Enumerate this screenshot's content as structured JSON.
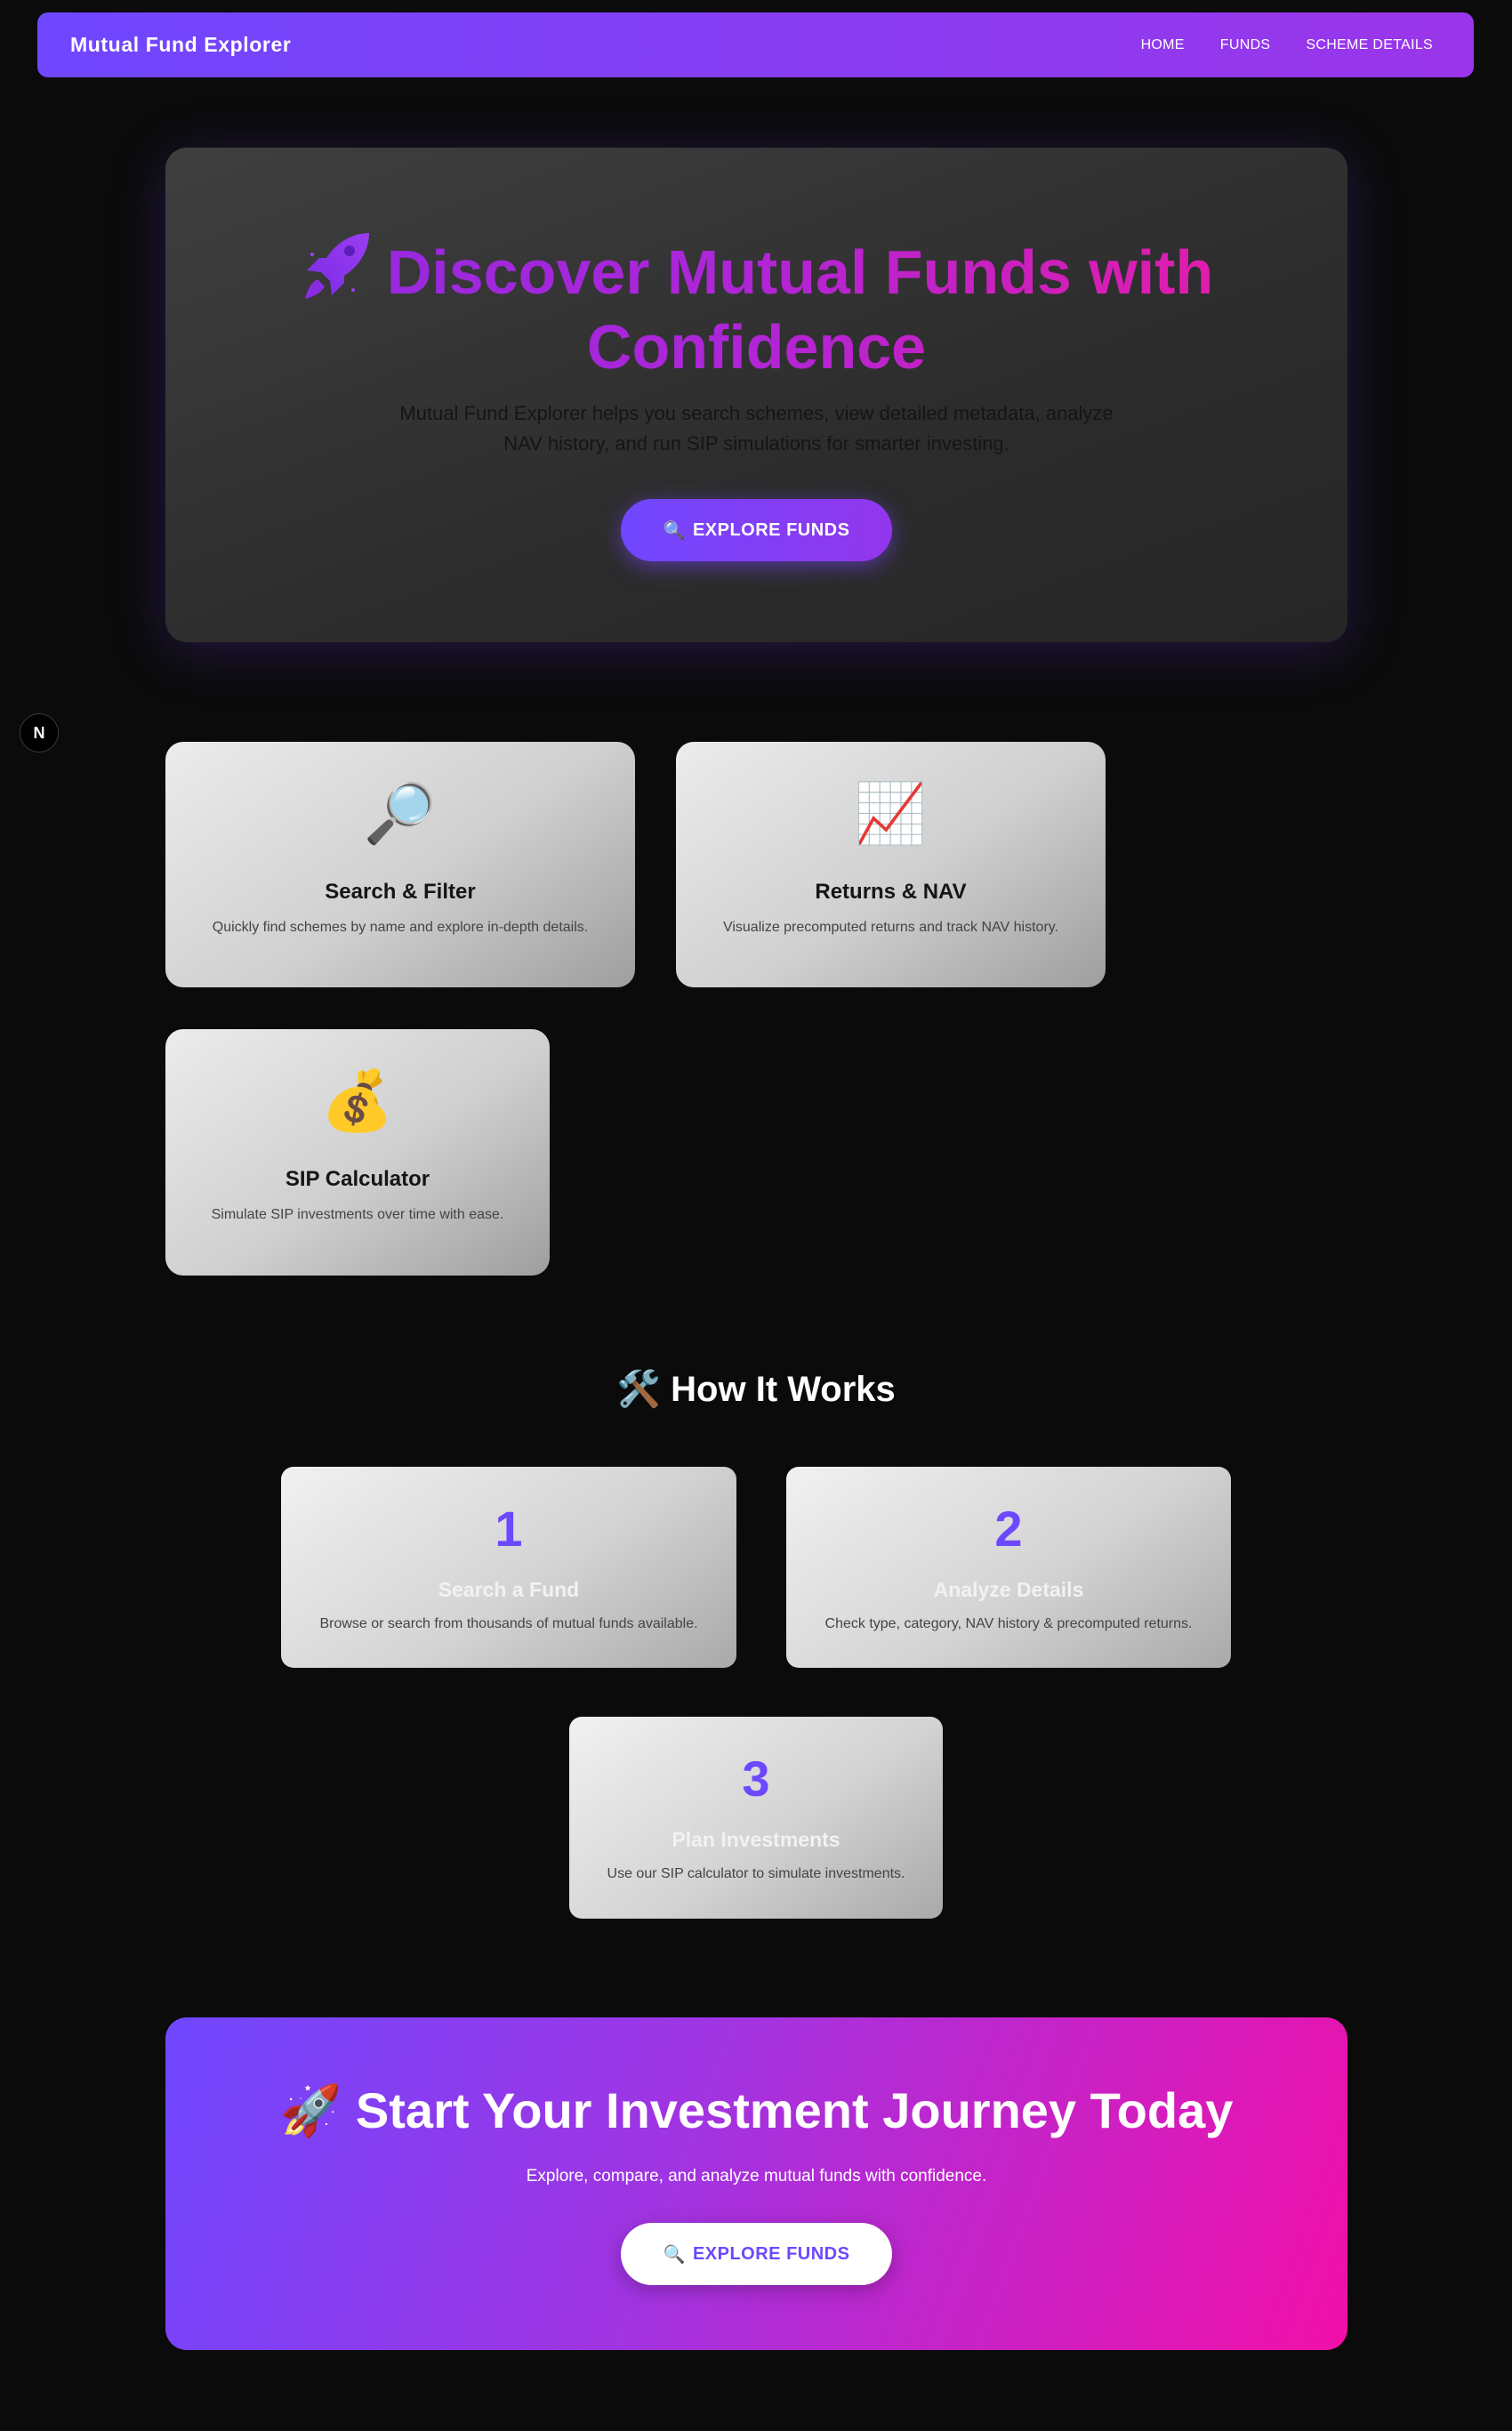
{
  "navbar": {
    "brand": "Mutual Fund Explorer",
    "links": [
      "HOME",
      "FUNDS",
      "SCHEME DETAILS"
    ]
  },
  "hero": {
    "title": "Discover Mutual Funds with Confidence",
    "subtitle": "Mutual Fund Explorer helps you search schemes, view detailed metadata, analyze NAV history, and run SIP simulations for smarter investing.",
    "button_icon": "🔍",
    "button_label": "EXPLORE FUNDS",
    "title_icon": "rocket-icon"
  },
  "badge": {
    "label": "N"
  },
  "features": [
    {
      "icon": "🔎",
      "icon_name": "magnifier-icon",
      "title": "Search & Filter",
      "desc": "Quickly find schemes by name and explore in-depth details."
    },
    {
      "icon": "📈",
      "icon_name": "chart-up-icon",
      "title": "Returns & NAV",
      "desc": "Visualize precomputed returns and track NAV history."
    },
    {
      "icon": "💰",
      "icon_name": "money-bag-icon",
      "title": "SIP Calculator",
      "desc": "Simulate SIP investments over time with ease."
    }
  ],
  "how_it_works": {
    "icon": "🛠️",
    "title": "How It Works",
    "steps": [
      {
        "num": "1",
        "title": "Search a Fund",
        "desc": "Browse or search from thousands of mutual funds available."
      },
      {
        "num": "2",
        "title": "Analyze Details",
        "desc": "Check type, category, NAV history & precomputed returns."
      },
      {
        "num": "3",
        "title": "Plan Investments",
        "desc": "Use our SIP calculator to simulate investments."
      }
    ]
  },
  "cta": {
    "icon": "🚀",
    "title": "Start Your Investment Journey Today",
    "subtitle": "Explore, compare, and analyze mutual funds with confidence.",
    "button_icon": "🔍",
    "button_label": "EXPLORE FUNDS"
  },
  "colors": {
    "accent": "#6c48ff",
    "accent_pink": "#f20fa8",
    "background": "#0b0b0b"
  }
}
